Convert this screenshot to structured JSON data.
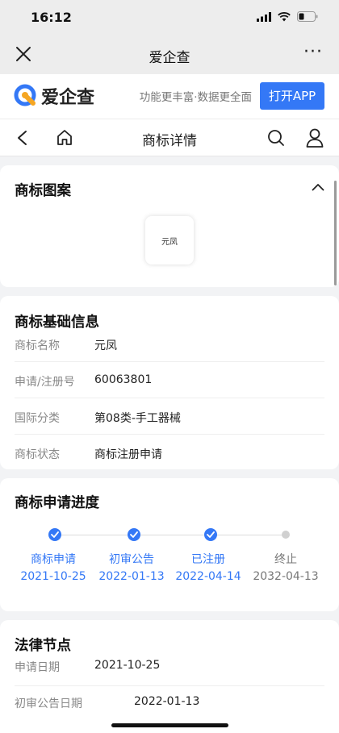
{
  "status": {
    "time": "16:12"
  },
  "wechat": {
    "title": "爱企查",
    "more": "···"
  },
  "brand": {
    "name": "爱企查",
    "slogan": "功能更丰富·数据更全面",
    "open_app": "打开APP",
    "logo_color": "#3478f6",
    "accent_orange": "#f5a623"
  },
  "nav": {
    "title": "商标详情"
  },
  "pattern": {
    "title": "商标图案",
    "thumb_text": "元凤"
  },
  "basic": {
    "title": "商标基础信息",
    "rows": [
      {
        "label": "商标名称",
        "value": "元凤"
      },
      {
        "label": "申请/注册号",
        "value": "60063801"
      },
      {
        "label": "国际分类",
        "value": "第08类-手工器械"
      },
      {
        "label": "商标状态",
        "value": "商标注册申请"
      }
    ]
  },
  "progress": {
    "title": "商标申请进度",
    "steps": [
      {
        "label": "商标申请",
        "date": "2021-10-25",
        "done": true
      },
      {
        "label": "初审公告",
        "date": "2022-01-13",
        "done": true
      },
      {
        "label": "已注册",
        "date": "2022-04-14",
        "done": true
      },
      {
        "label": "终止",
        "date": "2032-04-13",
        "done": false
      }
    ]
  },
  "legal": {
    "title": "法律节点",
    "rows": [
      {
        "label": "申请日期",
        "value": "2021-10-25"
      },
      {
        "label": "初审公告日期",
        "value": "2022-01-13"
      }
    ]
  }
}
